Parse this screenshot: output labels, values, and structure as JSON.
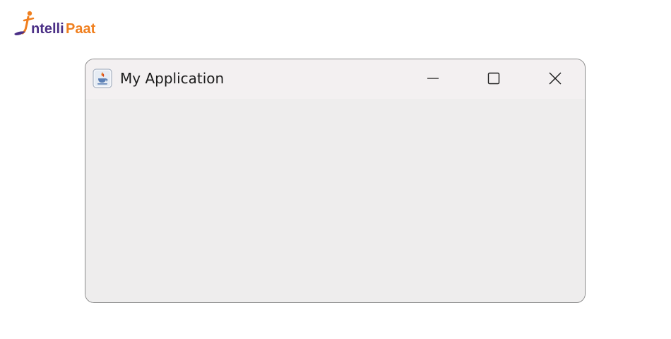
{
  "logo": {
    "text": "ntelliPaat",
    "brand_colors": {
      "orange": "#f07f1e",
      "purple": "#4b2f86"
    }
  },
  "window": {
    "title": "My Application",
    "icon": "java-app-icon",
    "controls": {
      "minimize": "minimize-icon",
      "maximize": "maximize-icon",
      "close": "close-icon"
    }
  }
}
